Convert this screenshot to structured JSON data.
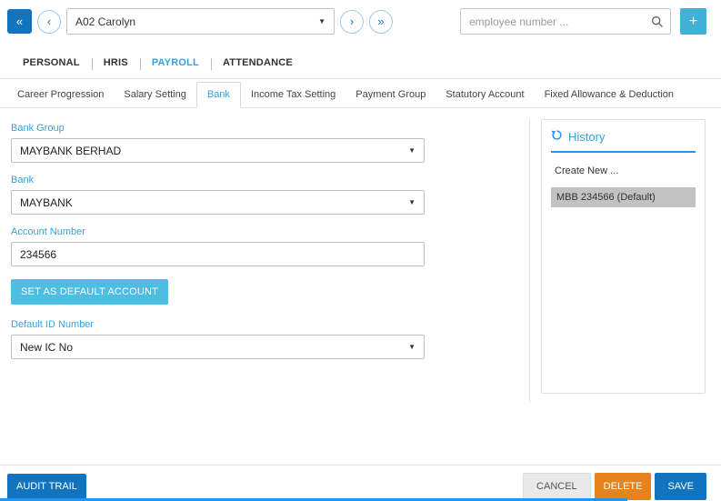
{
  "colors": {
    "accent": "#1273bf",
    "link_blue": "#35a3da",
    "light_button": "#4dbde3",
    "add_button": "#41b1d6",
    "delete_orange": "#e8821c",
    "selected_gray": "#c2c2c2",
    "history_underline": "#2196f3"
  },
  "icons": {
    "first": "«",
    "prev": "‹",
    "next": "›",
    "last": "»",
    "caret_down": "▼"
  },
  "header": {
    "employee_value": "A02 Carolyn",
    "search_placeholder": "employee number ...",
    "add_label": "+"
  },
  "main_tabs": [
    {
      "label": "PERSONAL",
      "active": false
    },
    {
      "label": "HRIS",
      "active": false
    },
    {
      "label": "PAYROLL",
      "active": true
    },
    {
      "label": "ATTENDANCE",
      "active": false
    }
  ],
  "sub_tabs": [
    {
      "label": "Career Progression",
      "active": false
    },
    {
      "label": "Salary Setting",
      "active": false
    },
    {
      "label": "Bank",
      "active": true
    },
    {
      "label": "Income Tax Setting",
      "active": false
    },
    {
      "label": "Payment Group",
      "active": false
    },
    {
      "label": "Statutory Account",
      "active": false
    },
    {
      "label": "Fixed Allowance & Deduction",
      "active": false
    }
  ],
  "form": {
    "bank_group_label": "Bank Group",
    "bank_group_value": "MAYBANK BERHAD",
    "bank_label": "Bank",
    "bank_value": "MAYBANK",
    "account_number_label": "Account Number",
    "account_number_value": "234566",
    "set_default_button": "SET AS DEFAULT ACCOUNT",
    "default_id_label": "Default ID Number",
    "default_id_value": "New IC No"
  },
  "history": {
    "title": "History",
    "items": [
      {
        "label": "Create New ...",
        "selected": false
      },
      {
        "label": "MBB 234566 (Default)",
        "selected": true
      }
    ]
  },
  "footer": {
    "audit_trail": "AUDIT TRAIL",
    "cancel": "CANCEL",
    "delete": "DELETE",
    "save": "SAVE"
  }
}
